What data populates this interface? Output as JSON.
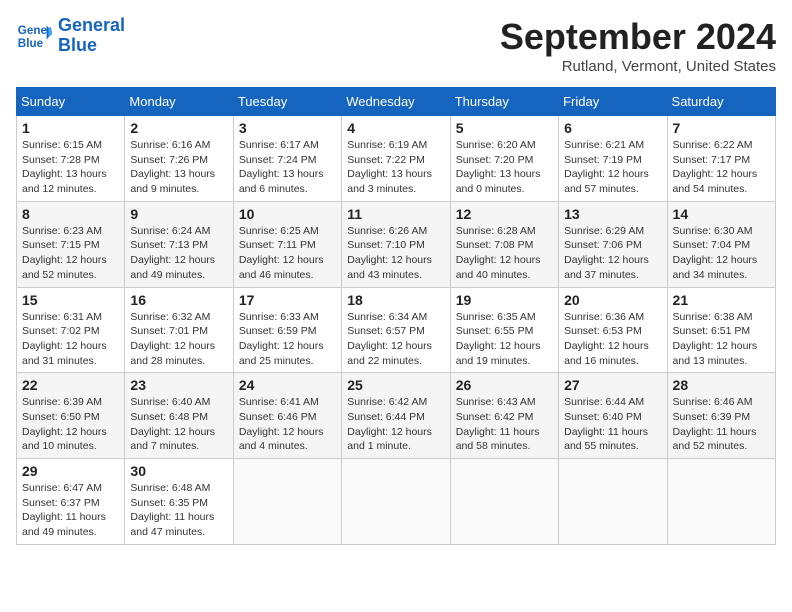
{
  "logo": {
    "line1": "General",
    "line2": "Blue"
  },
  "title": "September 2024",
  "subtitle": "Rutland, Vermont, United States",
  "days_of_week": [
    "Sunday",
    "Monday",
    "Tuesday",
    "Wednesday",
    "Thursday",
    "Friday",
    "Saturday"
  ],
  "weeks": [
    [
      {
        "day": "1",
        "sunrise": "Sunrise: 6:15 AM",
        "sunset": "Sunset: 7:28 PM",
        "daylight": "Daylight: 13 hours and 12 minutes."
      },
      {
        "day": "2",
        "sunrise": "Sunrise: 6:16 AM",
        "sunset": "Sunset: 7:26 PM",
        "daylight": "Daylight: 13 hours and 9 minutes."
      },
      {
        "day": "3",
        "sunrise": "Sunrise: 6:17 AM",
        "sunset": "Sunset: 7:24 PM",
        "daylight": "Daylight: 13 hours and 6 minutes."
      },
      {
        "day": "4",
        "sunrise": "Sunrise: 6:19 AM",
        "sunset": "Sunset: 7:22 PM",
        "daylight": "Daylight: 13 hours and 3 minutes."
      },
      {
        "day": "5",
        "sunrise": "Sunrise: 6:20 AM",
        "sunset": "Sunset: 7:20 PM",
        "daylight": "Daylight: 13 hours and 0 minutes."
      },
      {
        "day": "6",
        "sunrise": "Sunrise: 6:21 AM",
        "sunset": "Sunset: 7:19 PM",
        "daylight": "Daylight: 12 hours and 57 minutes."
      },
      {
        "day": "7",
        "sunrise": "Sunrise: 6:22 AM",
        "sunset": "Sunset: 7:17 PM",
        "daylight": "Daylight: 12 hours and 54 minutes."
      }
    ],
    [
      {
        "day": "8",
        "sunrise": "Sunrise: 6:23 AM",
        "sunset": "Sunset: 7:15 PM",
        "daylight": "Daylight: 12 hours and 52 minutes."
      },
      {
        "day": "9",
        "sunrise": "Sunrise: 6:24 AM",
        "sunset": "Sunset: 7:13 PM",
        "daylight": "Daylight: 12 hours and 49 minutes."
      },
      {
        "day": "10",
        "sunrise": "Sunrise: 6:25 AM",
        "sunset": "Sunset: 7:11 PM",
        "daylight": "Daylight: 12 hours and 46 minutes."
      },
      {
        "day": "11",
        "sunrise": "Sunrise: 6:26 AM",
        "sunset": "Sunset: 7:10 PM",
        "daylight": "Daylight: 12 hours and 43 minutes."
      },
      {
        "day": "12",
        "sunrise": "Sunrise: 6:28 AM",
        "sunset": "Sunset: 7:08 PM",
        "daylight": "Daylight: 12 hours and 40 minutes."
      },
      {
        "day": "13",
        "sunrise": "Sunrise: 6:29 AM",
        "sunset": "Sunset: 7:06 PM",
        "daylight": "Daylight: 12 hours and 37 minutes."
      },
      {
        "day": "14",
        "sunrise": "Sunrise: 6:30 AM",
        "sunset": "Sunset: 7:04 PM",
        "daylight": "Daylight: 12 hours and 34 minutes."
      }
    ],
    [
      {
        "day": "15",
        "sunrise": "Sunrise: 6:31 AM",
        "sunset": "Sunset: 7:02 PM",
        "daylight": "Daylight: 12 hours and 31 minutes."
      },
      {
        "day": "16",
        "sunrise": "Sunrise: 6:32 AM",
        "sunset": "Sunset: 7:01 PM",
        "daylight": "Daylight: 12 hours and 28 minutes."
      },
      {
        "day": "17",
        "sunrise": "Sunrise: 6:33 AM",
        "sunset": "Sunset: 6:59 PM",
        "daylight": "Daylight: 12 hours and 25 minutes."
      },
      {
        "day": "18",
        "sunrise": "Sunrise: 6:34 AM",
        "sunset": "Sunset: 6:57 PM",
        "daylight": "Daylight: 12 hours and 22 minutes."
      },
      {
        "day": "19",
        "sunrise": "Sunrise: 6:35 AM",
        "sunset": "Sunset: 6:55 PM",
        "daylight": "Daylight: 12 hours and 19 minutes."
      },
      {
        "day": "20",
        "sunrise": "Sunrise: 6:36 AM",
        "sunset": "Sunset: 6:53 PM",
        "daylight": "Daylight: 12 hours and 16 minutes."
      },
      {
        "day": "21",
        "sunrise": "Sunrise: 6:38 AM",
        "sunset": "Sunset: 6:51 PM",
        "daylight": "Daylight: 12 hours and 13 minutes."
      }
    ],
    [
      {
        "day": "22",
        "sunrise": "Sunrise: 6:39 AM",
        "sunset": "Sunset: 6:50 PM",
        "daylight": "Daylight: 12 hours and 10 minutes."
      },
      {
        "day": "23",
        "sunrise": "Sunrise: 6:40 AM",
        "sunset": "Sunset: 6:48 PM",
        "daylight": "Daylight: 12 hours and 7 minutes."
      },
      {
        "day": "24",
        "sunrise": "Sunrise: 6:41 AM",
        "sunset": "Sunset: 6:46 PM",
        "daylight": "Daylight: 12 hours and 4 minutes."
      },
      {
        "day": "25",
        "sunrise": "Sunrise: 6:42 AM",
        "sunset": "Sunset: 6:44 PM",
        "daylight": "Daylight: 12 hours and 1 minute."
      },
      {
        "day": "26",
        "sunrise": "Sunrise: 6:43 AM",
        "sunset": "Sunset: 6:42 PM",
        "daylight": "Daylight: 11 hours and 58 minutes."
      },
      {
        "day": "27",
        "sunrise": "Sunrise: 6:44 AM",
        "sunset": "Sunset: 6:40 PM",
        "daylight": "Daylight: 11 hours and 55 minutes."
      },
      {
        "day": "28",
        "sunrise": "Sunrise: 6:46 AM",
        "sunset": "Sunset: 6:39 PM",
        "daylight": "Daylight: 11 hours and 52 minutes."
      }
    ],
    [
      {
        "day": "29",
        "sunrise": "Sunrise: 6:47 AM",
        "sunset": "Sunset: 6:37 PM",
        "daylight": "Daylight: 11 hours and 49 minutes."
      },
      {
        "day": "30",
        "sunrise": "Sunrise: 6:48 AM",
        "sunset": "Sunset: 6:35 PM",
        "daylight": "Daylight: 11 hours and 47 minutes."
      },
      null,
      null,
      null,
      null,
      null
    ]
  ]
}
